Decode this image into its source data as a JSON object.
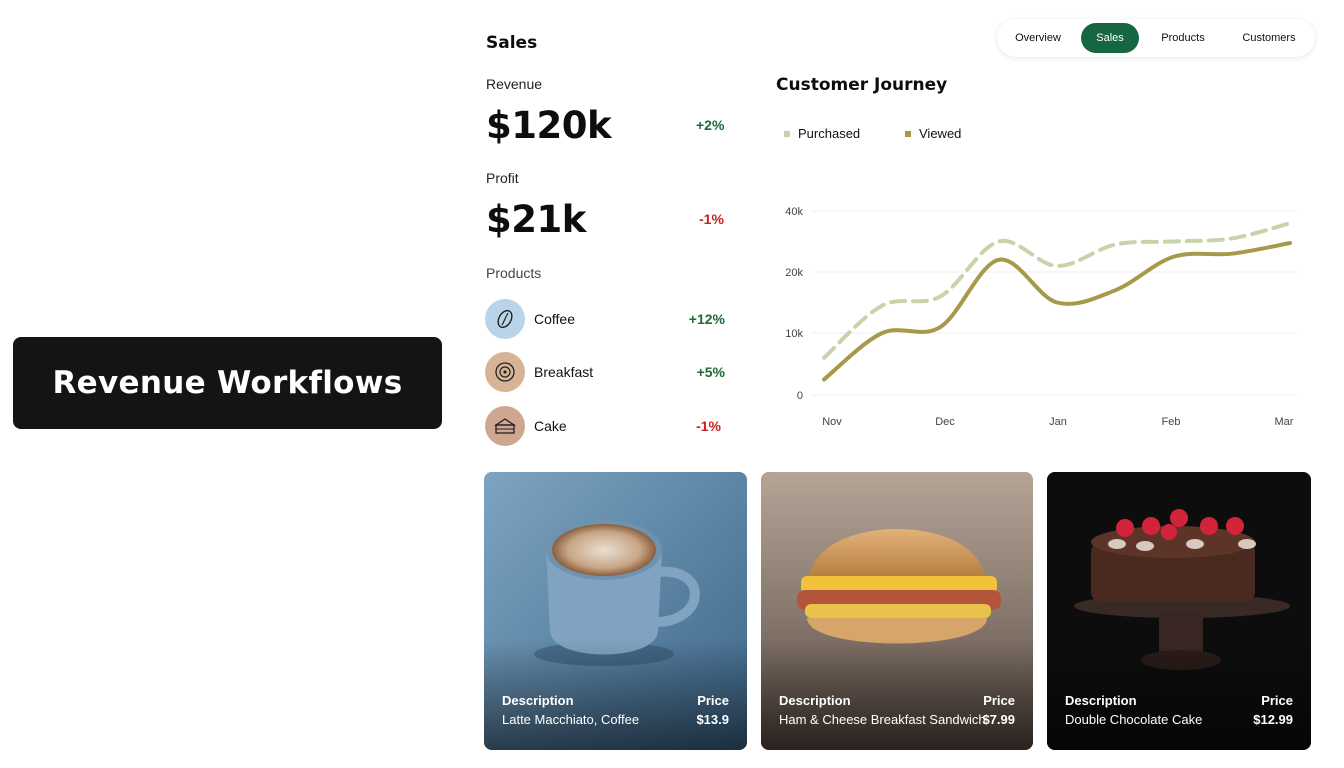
{
  "hero": {
    "label": "Revenue Workflows"
  },
  "tabs": [
    {
      "label": "Overview",
      "active": false
    },
    {
      "label": "Sales",
      "active": true
    },
    {
      "label": "Products",
      "active": false
    },
    {
      "label": "Customers",
      "active": false
    }
  ],
  "sales": {
    "title": "Sales",
    "revenue": {
      "label": "Revenue",
      "value": "$120k",
      "change": "+2%"
    },
    "profit": {
      "label": "Profit",
      "value": "$21k",
      "change": "-1%"
    },
    "products_label": "Products",
    "products": [
      {
        "name": "Coffee",
        "change": "+12%",
        "icon": "coffee-bean-icon"
      },
      {
        "name": "Breakfast",
        "change": "+5%",
        "icon": "plate-icon"
      },
      {
        "name": "Cake",
        "change": "-1%",
        "icon": "cake-icon"
      }
    ]
  },
  "journey": {
    "title": "Customer Journey",
    "legend": [
      {
        "name": "Purchased",
        "color": "#c9d3a8"
      },
      {
        "name": "Viewed",
        "color": "#a69a4a"
      }
    ]
  },
  "chart_data": {
    "type": "line",
    "title": "Customer Journey",
    "xlabel": "",
    "ylabel": "",
    "categories": [
      "Nov",
      "Dec",
      "Jan",
      "Feb",
      "Mar"
    ],
    "y_ticks": [
      "0",
      "10k",
      "20k",
      "40k"
    ],
    "grid": true,
    "legend_position": "top-left",
    "series": [
      {
        "name": "Purchased",
        "style": "dashed",
        "color": "#c9d3a8",
        "points": [
          [
            0,
            6
          ],
          [
            0.5,
            14.5
          ],
          [
            1,
            16
          ],
          [
            1.5,
            30
          ],
          [
            2,
            22
          ],
          [
            2.5,
            29
          ],
          [
            3,
            30
          ],
          [
            3.5,
            31
          ],
          [
            4,
            36
          ]
        ]
      },
      {
        "name": "Viewed",
        "style": "solid",
        "color": "#a69a4a",
        "points": [
          [
            0,
            2.5
          ],
          [
            0.5,
            10
          ],
          [
            1,
            11
          ],
          [
            1.5,
            24
          ],
          [
            2,
            15
          ],
          [
            2.5,
            17
          ],
          [
            3,
            25
          ],
          [
            3.5,
            26
          ],
          [
            4,
            29.5
          ]
        ]
      }
    ]
  },
  "cards": [
    {
      "desc_label": "Description",
      "desc": "Latte Macchiato, Coffee",
      "price_label": "Price",
      "price": "$13.9"
    },
    {
      "desc_label": "Description",
      "desc": "Ham & Cheese Breakfast Sandwich",
      "price_label": "Price",
      "price": "$7.99"
    },
    {
      "desc_label": "Description",
      "desc": "Double Chocolate Cake",
      "price_label": "Price",
      "price": "$12.99"
    }
  ]
}
